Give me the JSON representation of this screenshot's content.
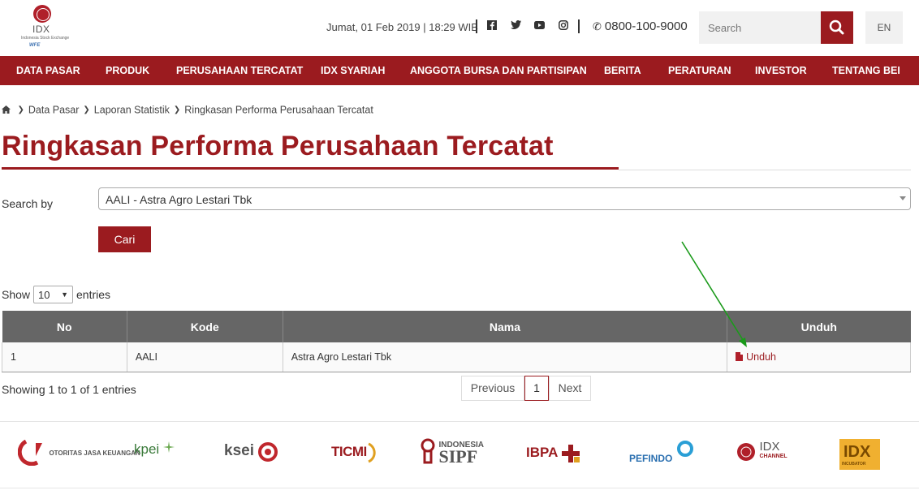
{
  "brand": {
    "logo_text": "IDX",
    "logo_subtitle": "Indonesia Stock Exchange",
    "logo_member": "WFE",
    "colors": {
      "primary": "#9b1b1f",
      "table_header": "#666666"
    }
  },
  "header": {
    "datetime": "Jumat, 01 Feb 2019 | 18:29 WIB",
    "social_icons": [
      "facebook-icon",
      "twitter-icon",
      "youtube-icon",
      "instagram-icon"
    ],
    "phone": "0800-100-9000",
    "search_placeholder": "Search",
    "language": "EN"
  },
  "nav": {
    "items": [
      "DATA PASAR",
      "PRODUK",
      "PERUSAHAAN TERCATAT",
      "IDX SYARIAH",
      "ANGGOTA BURSA DAN PARTISIPAN",
      "BERITA",
      "PERATURAN",
      "INVESTOR",
      "TENTANG BEI"
    ]
  },
  "breadcrumb": [
    "Data Pasar",
    "Laporan Statistik",
    "Ringkasan Performa Perusahaan Tercatat"
  ],
  "page_title": "Ringkasan Performa Perusahaan Tercatat",
  "search": {
    "label": "Search by",
    "selected": "AALI - Astra Agro Lestari Tbk",
    "button": "Cari"
  },
  "entries": {
    "show_label": "Show",
    "value": "10",
    "suffix": "entries"
  },
  "table": {
    "columns": [
      "No",
      "Kode",
      "Nama",
      "Unduh"
    ],
    "rows": [
      {
        "no": "1",
        "kode": "AALI",
        "nama": "Astra Agro Lestari Tbk",
        "unduh": "Unduh"
      }
    ]
  },
  "pagination": {
    "info": "Showing 1 to 1 of 1 entries",
    "previous": "Previous",
    "current": "1",
    "next": "Next"
  },
  "partners": [
    {
      "name": "OJK",
      "caption": "OTORITAS JASA KEUANGAN"
    },
    {
      "name": "kpei",
      "caption": ""
    },
    {
      "name": "ksei",
      "caption": ""
    },
    {
      "name": "TICMI",
      "caption": ""
    },
    {
      "name": "SIPF",
      "caption": "INDONESIA"
    },
    {
      "name": "IBPA",
      "caption": ""
    },
    {
      "name": "PEFINDO",
      "caption": ""
    },
    {
      "name": "IDX",
      "caption": "CHANNEL"
    },
    {
      "name": "IDX",
      "caption": "INCUBATOR"
    }
  ],
  "annotation": {
    "color": "#1a9a1a",
    "target": "Unduh"
  }
}
